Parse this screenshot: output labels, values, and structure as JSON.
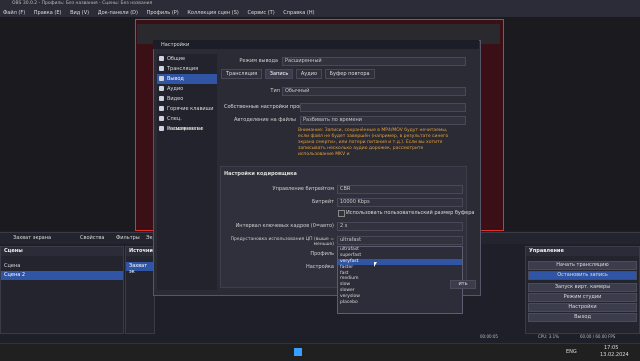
{
  "window": {
    "title": "OBS 30.0.2 - Профиль: Без названия - Сцены: Без названия"
  },
  "menu": [
    "Файл (F)",
    "Правка (E)",
    "Вид (V)",
    "Док-панели (D)",
    "Профиль (P)",
    "Коллекция сцен (S)",
    "Сервис (T)",
    "Справка (H)"
  ],
  "controls": {
    "source_name": "Захват экрана",
    "properties": "Свойства",
    "filters": "Фильтры",
    "more": "Экр"
  },
  "scenes": {
    "title": "Сцены",
    "items": [
      "Сцена",
      "Сцена 2"
    ],
    "selected": 1
  },
  "sources": {
    "title": "Источни",
    "items": [
      "Захват эк"
    ]
  },
  "controls_dock": {
    "title": "Управление",
    "buttons": [
      "Начать трансляцию",
      "Остановить запись",
      "Запуск вирт. камеры",
      "Режим студии",
      "Настройки",
      "Выход"
    ],
    "active": 1
  },
  "status": {
    "time": "00:00:05",
    "cpu": "CPU: 3.1%",
    "fps": "60.00 / 60.00 FPS",
    "rec": "00:04:30"
  },
  "taskbar": {
    "lang": "ENG",
    "time": "17:05",
    "date": "13.02.2024"
  },
  "settings": {
    "title": "Настройки",
    "nav": [
      "Общие",
      "Трансляция",
      "Вывод",
      "Аудио",
      "Видео",
      "Горячие клавиши",
      "Спец. возможности",
      "Расширенные"
    ],
    "nav_selected": 2,
    "output_mode_label": "Режим вывода",
    "output_mode_value": "Расширенный",
    "tabs": [
      "Трансляция",
      "Запись",
      "Аудио",
      "Буфер повтора"
    ],
    "tab_selected": 1,
    "type_label": "Тип",
    "type_value": "Обычный",
    "custom_muxer_label": "Собственные настройки производителя",
    "auto_split_label": "Автоделение на файлы",
    "auto_split_value": "Разбивать по времени",
    "warning": "Внимание: Записи, сохранённые в MP4/MOV будут нечитаемы, если файл не будет завершён (например, в результате синего экрана смерти», или потери питания и т.д.). Если вы хотите записывать несколько аудио дорожек, рассмотрите использование MKV и",
    "encoder_section": "Настройки кодировщика",
    "rate_control_label": "Управление битрейтом",
    "rate_control_value": "CBR",
    "bitrate_label": "Битрейт",
    "bitrate_value": "10000 Kbps",
    "custom_buffer_label": "Использовать пользовательский размер буфера",
    "keyframe_label": "Интервал ключевых кадров (0=авто)",
    "keyframe_value": "2 s",
    "preset_label": "Предустановка использования ЦП (выше = меньше)",
    "preset_value": "ultrafast",
    "profile_label": "Профиль",
    "tune_label": "Настройка",
    "presets": [
      "ultrafast",
      "superfast",
      "veryfast",
      "faster",
      "fast",
      "medium",
      "slow",
      "slower",
      "veryslow",
      "placebo"
    ],
    "preset_hover": 2,
    "apply": "ить"
  }
}
